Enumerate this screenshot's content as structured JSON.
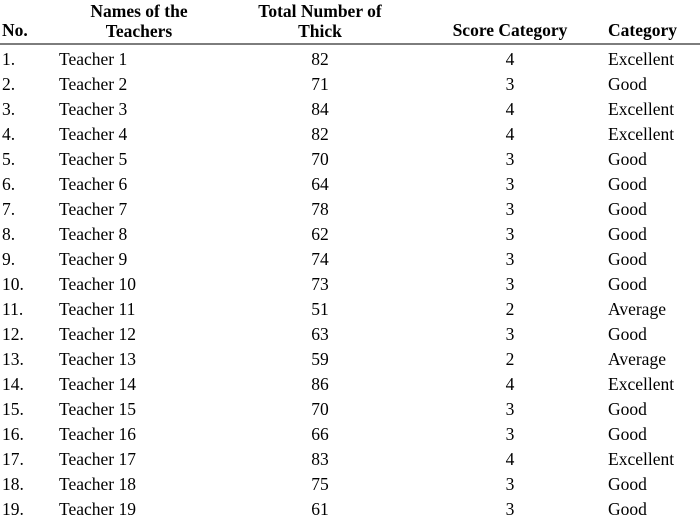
{
  "document": {
    "type": "table",
    "title_visible": false
  },
  "table": {
    "columns": [
      {
        "key": "no",
        "label": "No.",
        "align": "left",
        "name": "column-no"
      },
      {
        "key": "name",
        "label": "Names of the Teachers",
        "align": "center",
        "name": "column-names-of-the-teachers"
      },
      {
        "key": "total",
        "label": "Total Number of Thick",
        "align": "center",
        "name": "column-total-number-of-thick"
      },
      {
        "key": "score",
        "label": "Score Category",
        "align": "center",
        "name": "column-score-category"
      },
      {
        "key": "category",
        "label": "Category",
        "align": "left",
        "name": "column-category"
      }
    ],
    "header_lines": {
      "no": [
        "No."
      ],
      "name": [
        "Names of the",
        "Teachers"
      ],
      "total": [
        "Total Number of",
        "Thick"
      ],
      "score": [
        "Score Category"
      ],
      "category": [
        "Category"
      ]
    },
    "rows": [
      {
        "no": "1.",
        "name": "Teacher 1",
        "total": "82",
        "score": "4",
        "category": "Excellent"
      },
      {
        "no": "2.",
        "name": "Teacher 2",
        "total": "71",
        "score": "3",
        "category": "Good"
      },
      {
        "no": "3.",
        "name": "Teacher 3",
        "total": "84",
        "score": "4",
        "category": "Excellent"
      },
      {
        "no": "4.",
        "name": "Teacher 4",
        "total": "82",
        "score": "4",
        "category": "Excellent"
      },
      {
        "no": "5.",
        "name": "Teacher 5",
        "total": "70",
        "score": "3",
        "category": "Good"
      },
      {
        "no": "6.",
        "name": "Teacher 6",
        "total": "64",
        "score": "3",
        "category": "Good"
      },
      {
        "no": "7.",
        "name": "Teacher 7",
        "total": "78",
        "score": "3",
        "category": "Good"
      },
      {
        "no": "8.",
        "name": "Teacher 8",
        "total": "62",
        "score": "3",
        "category": "Good"
      },
      {
        "no": "9.",
        "name": "Teacher 9",
        "total": "74",
        "score": "3",
        "category": "Good"
      },
      {
        "no": "10.",
        "name": "Teacher 10",
        "total": "73",
        "score": "3",
        "category": "Good"
      },
      {
        "no": "11.",
        "name": "Teacher 11",
        "total": "51",
        "score": "2",
        "category": "Average"
      },
      {
        "no": "12.",
        "name": "Teacher 12",
        "total": "63",
        "score": "3",
        "category": "Good"
      },
      {
        "no": "13.",
        "name": "Teacher 13",
        "total": "59",
        "score": "2",
        "category": "Average"
      },
      {
        "no": "14.",
        "name": "Teacher 14",
        "total": "86",
        "score": "4",
        "category": "Excellent"
      },
      {
        "no": "15.",
        "name": "Teacher 15",
        "total": "70",
        "score": "3",
        "category": "Good"
      },
      {
        "no": "16.",
        "name": "Teacher 16",
        "total": "66",
        "score": "3",
        "category": "Good"
      },
      {
        "no": "17.",
        "name": "Teacher 17",
        "total": "83",
        "score": "4",
        "category": "Excellent"
      },
      {
        "no": "18.",
        "name": "Teacher 18",
        "total": "75",
        "score": "3",
        "category": "Good"
      },
      {
        "no": "19.",
        "name": "Teacher 19",
        "total": "61",
        "score": "3",
        "category": "Good"
      }
    ]
  },
  "style": {
    "text_color": "#000000",
    "rule_color": "#7d7d7d",
    "background": "#ffffff"
  }
}
